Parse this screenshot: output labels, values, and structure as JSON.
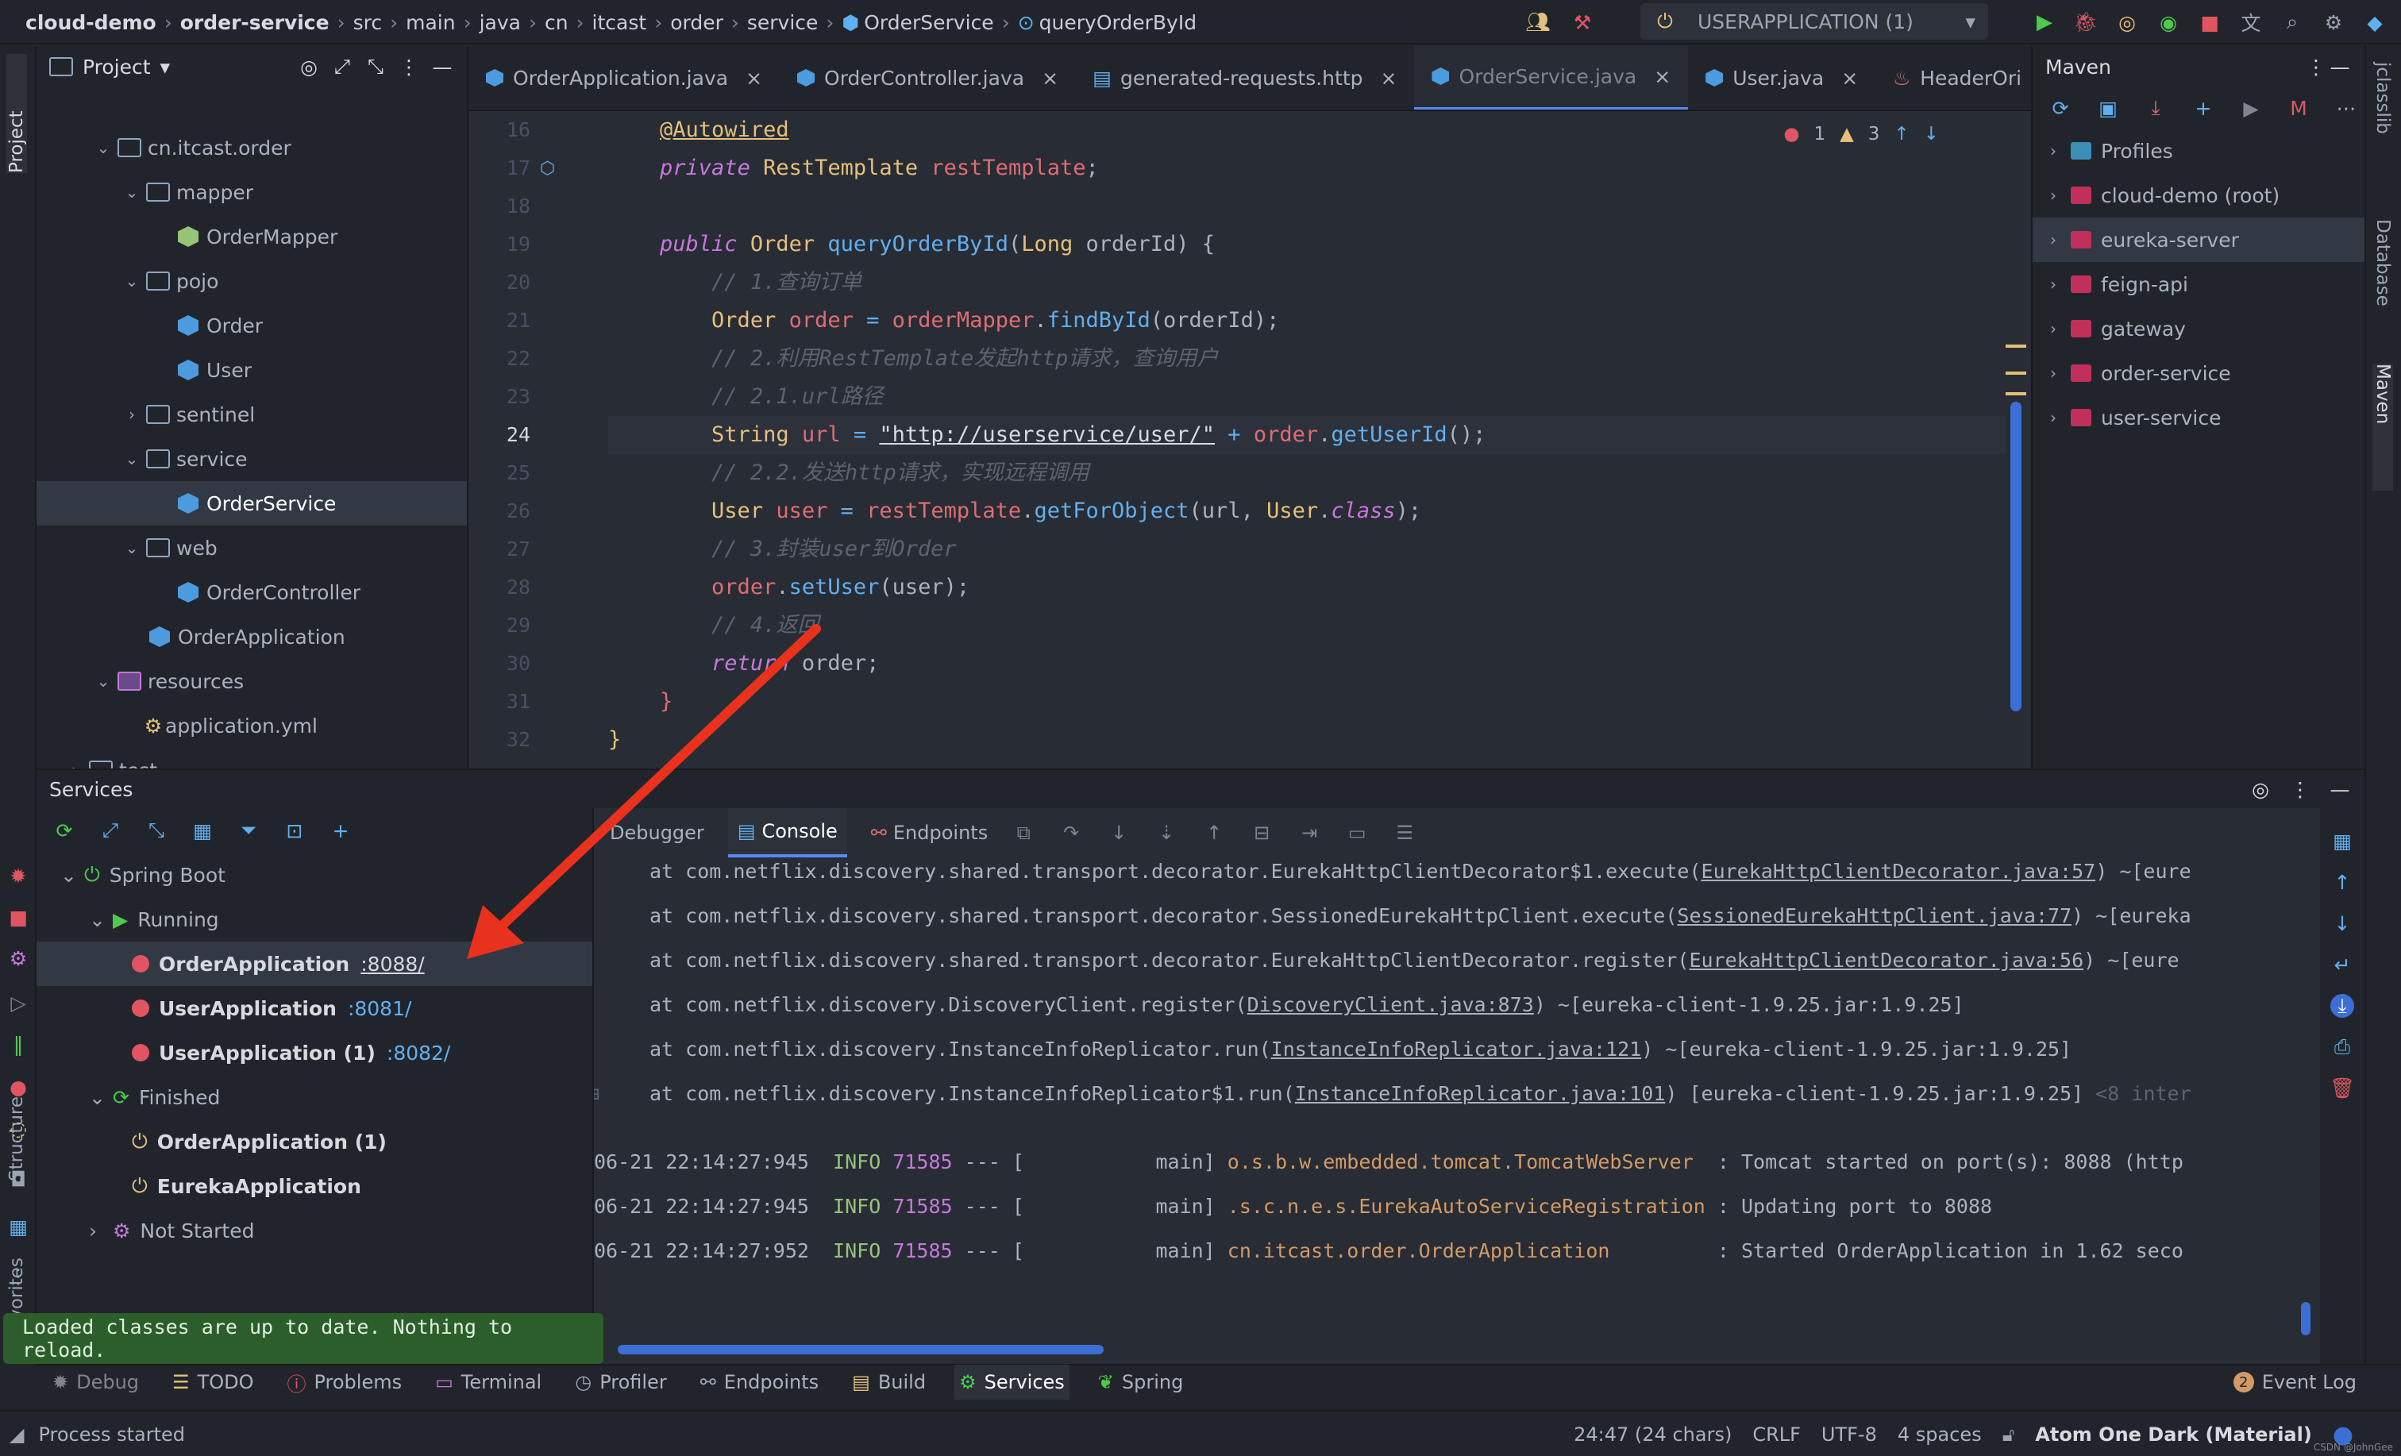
{
  "breadcrumb": [
    "cloud-demo",
    "order-service",
    "src",
    "main",
    "java",
    "cn",
    "itcast",
    "order",
    "service",
    "OrderService",
    "queryOrderById"
  ],
  "run_config": "USERAPPLICATION (1)",
  "project_panel": {
    "title": "Project",
    "tree": [
      {
        "label": "cn.itcast.order",
        "indent": 2,
        "arrow": "v",
        "kind": "folder"
      },
      {
        "label": "mapper",
        "indent": 3,
        "arrow": "v",
        "kind": "folder"
      },
      {
        "label": "OrderMapper",
        "indent": 4,
        "arrow": "",
        "kind": "iface"
      },
      {
        "label": "pojo",
        "indent": 3,
        "arrow": "v",
        "kind": "folder"
      },
      {
        "label": "Order",
        "indent": 4,
        "arrow": "",
        "kind": "class"
      },
      {
        "label": "User",
        "indent": 4,
        "arrow": "",
        "kind": "class"
      },
      {
        "label": "sentinel",
        "indent": 3,
        "arrow": ">",
        "kind": "folder"
      },
      {
        "label": "service",
        "indent": 3,
        "arrow": "v",
        "kind": "folder"
      },
      {
        "label": "OrderService",
        "indent": 4,
        "arrow": "",
        "kind": "class",
        "selected": true
      },
      {
        "label": "web",
        "indent": 3,
        "arrow": "v",
        "kind": "folder"
      },
      {
        "label": "OrderController",
        "indent": 4,
        "arrow": "",
        "kind": "class"
      },
      {
        "label": "OrderApplication",
        "indent": 3,
        "arrow": "",
        "kind": "class"
      },
      {
        "label": "resources",
        "indent": 2,
        "arrow": "v",
        "kind": "res"
      },
      {
        "label": "application.yml",
        "indent": 3,
        "arrow": "",
        "kind": "yml"
      },
      {
        "label": "test",
        "indent": 1,
        "arrow": ">",
        "kind": "folder"
      }
    ]
  },
  "editor_tabs": [
    {
      "label": "OrderApplication.java",
      "closable": true
    },
    {
      "label": "OrderController.java",
      "closable": true
    },
    {
      "label": "generated-requests.http",
      "closable": true
    },
    {
      "label": "OrderService.java",
      "closable": true,
      "active": true
    },
    {
      "label": "User.java",
      "closable": true
    },
    {
      "label": "HeaderOri",
      "closable": false
    }
  ],
  "inspections": {
    "errors": "1",
    "warnings": "3"
  },
  "line_numbers": [
    "16",
    "17",
    "18",
    "19",
    "20",
    "21",
    "22",
    "23",
    "24",
    "25",
    "26",
    "27",
    "28",
    "29",
    "30",
    "31",
    "32"
  ],
  "current_line": "24",
  "code": {
    "l16": "@Autowired",
    "l17a": "private ",
    "l17b": "RestTemplate ",
    "l17c": "restTemplate",
    "l17d": ";",
    "l19a": "public ",
    "l19b": "Order ",
    "l19c": "queryOrderById",
    "l19d": "(",
    "l19e": "Long ",
    "l19f": "orderId) {",
    "l20": "// 1.查询订单",
    "l21a": "Order ",
    "l21b": "order ",
    "l21c": "= ",
    "l21d": "orderMapper",
    "l21e": ".",
    "l21f": "findById",
    "l21g": "(orderId);",
    "l22": "// 2.利用RestTemplate发起http请求，查询用户",
    "l23": "// 2.1.url路径",
    "l24a": "String ",
    "l24b": "url ",
    "l24c": "= ",
    "l24d": "\"http://userservice/user/\"",
    "l24e": " + ",
    "l24f": "order",
    "l24g": ".",
    "l24h": "getUserId",
    "l24i": "();",
    "l25": "// 2.2.发送http请求，实现远程调用",
    "l26a": "User ",
    "l26b": "user ",
    "l26c": "= ",
    "l26d": "restTemplate",
    "l26e": ".",
    "l26f": "getForObject",
    "l26g": "(url, ",
    "l26h": "User",
    "l26i": ".",
    "l26j": "class",
    "l26k": ");",
    "l27": "// 3.封装user到Order",
    "l28a": "order",
    "l28b": ".",
    "l28c": "setUser",
    "l28d": "(user);",
    "l29": "// 4.返回",
    "l30a": "return ",
    "l30b": "order;",
    "l31": "}",
    "l32": "}"
  },
  "maven": {
    "title": "Maven",
    "items": [
      {
        "label": "Profiles",
        "kind": "profiles"
      },
      {
        "label": "cloud-demo (root)",
        "kind": "mvn"
      },
      {
        "label": "eureka-server",
        "kind": "mvn",
        "selected": true
      },
      {
        "label": "feign-api",
        "kind": "mvn"
      },
      {
        "label": "gateway",
        "kind": "mvn"
      },
      {
        "label": "order-service",
        "kind": "mvn"
      },
      {
        "label": "user-service",
        "kind": "mvn"
      }
    ]
  },
  "right_strip": [
    "jclasslib",
    "Database",
    "Maven"
  ],
  "left_strip": [
    "Project",
    "Structure",
    "Favorites"
  ],
  "services": {
    "title": "Services",
    "tree": {
      "spring_boot": "Spring Boot",
      "running": "Running",
      "running_items": [
        {
          "name": "OrderApplication",
          "port": ":8088/",
          "selected": true
        },
        {
          "name": "UserApplication",
          "port": ":8081/"
        },
        {
          "name": "UserApplication (1)",
          "port": ":8082/"
        }
      ],
      "finished": "Finished",
      "finished_items": [
        "OrderApplication (1)",
        "EurekaApplication"
      ],
      "not_started": "Not Started"
    },
    "console_tabs": [
      "Debugger",
      "Console",
      "Endpoints"
    ],
    "console_lines": [
      {
        "pre": "at com.netflix.discovery.shared.transport.decorator.EurekaHttpClientDecorator$1.execute(",
        "link": "EurekaHttpClientDecorator.java:57",
        "post": ") ~[eure"
      },
      {
        "pre": "at com.netflix.discovery.shared.transport.decorator.SessionedEurekaHttpClient.execute(",
        "link": "SessionedEurekaHttpClient.java:77",
        "post": ") ~[eureka"
      },
      {
        "pre": "at com.netflix.discovery.shared.transport.decorator.EurekaHttpClientDecorator.register(",
        "link": "EurekaHttpClientDecorator.java:56",
        "post": ") ~[eure"
      },
      {
        "pre": "at com.netflix.discovery.DiscoveryClient.register(",
        "link": "DiscoveryClient.java:873",
        "post": ") ~[eureka-client-1.9.25.jar:1.9.25]"
      },
      {
        "pre": "at com.netflix.discovery.InstanceInfoReplicator.run(",
        "link": "InstanceInfoReplicator.java:121",
        "post": ") ~[eureka-client-1.9.25.jar:1.9.25]"
      },
      {
        "pre": "at com.netflix.discovery.InstanceInfoReplicator$1.run(",
        "link": "InstanceInfoReplicator.java:101",
        "post": ") [eureka-client-1.9.25.jar:1.9.25] ",
        "tail": "<8 inter"
      }
    ],
    "log_lines": [
      {
        "ts": "06-21 22:14:27:945",
        "lvl": "INFO",
        "pid": "71585",
        "mid": " --- [           main] ",
        "logger": "o.s.b.w.embedded.tomcat.TomcatWebServer  ",
        "msg": ": Tomcat started on port(s): 8088 (http"
      },
      {
        "ts": "06-21 22:14:27:945",
        "lvl": "INFO",
        "pid": "71585",
        "mid": " --- [           main] ",
        "logger": ".s.c.n.e.s.EurekaAutoServiceRegistration ",
        "msg": ": Updating port to 8088"
      },
      {
        "ts": "06-21 22:14:27:952",
        "lvl": "INFO",
        "pid": "71585",
        "mid": " --- [           main] ",
        "logger": "cn.itcast.order.OrderApplication         ",
        "msg": ": Started OrderApplication in 1.62 seco"
      }
    ]
  },
  "toast": "Loaded classes are up to date. Nothing to reload.",
  "bottom_tabs": [
    {
      "label": "Debug"
    },
    {
      "label": "TODO"
    },
    {
      "label": "Problems"
    },
    {
      "label": "Terminal"
    },
    {
      "label": "Profiler"
    },
    {
      "label": "Endpoints"
    },
    {
      "label": "Build"
    },
    {
      "label": "Services",
      "active": true
    },
    {
      "label": "Spring"
    }
  ],
  "event_log": {
    "count": "2",
    "label": "Event Log"
  },
  "status": {
    "left": "Process started",
    "position": "24:47 (24 chars)",
    "line_sep": "CRLF",
    "encoding": "UTF-8",
    "indent": "4 spaces",
    "theme": "Atom One Dark (Material)",
    "watermark": "CSDN @JohnGee"
  }
}
